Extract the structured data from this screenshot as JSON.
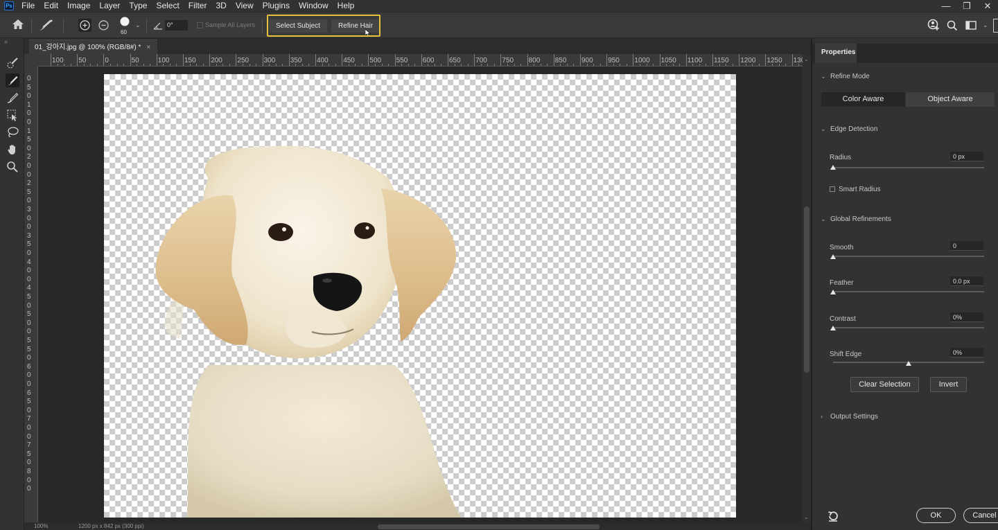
{
  "app": {
    "logo_text": "Ps"
  },
  "menu": [
    "File",
    "Edit",
    "Image",
    "Layer",
    "Type",
    "Select",
    "Filter",
    "3D",
    "View",
    "Plugins",
    "Window",
    "Help"
  ],
  "options_bar": {
    "brush_size": "60",
    "angle_value": "0°",
    "sample_all_layers": "Sample All Layers",
    "select_subject": "Select Subject",
    "refine_hair": "Refine Hair"
  },
  "document": {
    "tab_title": "01_강아지.jpg @ 100% (RGB/8#) *",
    "zoom_status": "100%",
    "size_status": "1200 px x 842 px (300 ppi)"
  },
  "ruler": {
    "top_labels": [
      "100",
      "50",
      "0",
      "50",
      "100",
      "150",
      "200",
      "250",
      "300",
      "350",
      "400",
      "450",
      "500",
      "550",
      "600",
      "650",
      "700",
      "750",
      "800",
      "850",
      "900",
      "950",
      "1000",
      "1050",
      "1100",
      "1150",
      "1200",
      "1250",
      "130"
    ],
    "left_labels": [
      "0",
      "5",
      "0",
      "1",
      "0",
      "0",
      "1",
      "5",
      "0",
      "2",
      "0",
      "0",
      "2",
      "5",
      "0",
      "3",
      "0",
      "0",
      "3",
      "5",
      "0",
      "4",
      "0",
      "0",
      "4",
      "5",
      "0",
      "5",
      "0",
      "0",
      "5",
      "5",
      "0",
      "6",
      "0",
      "0",
      "6",
      "5",
      "0",
      "7",
      "0",
      "0",
      "7",
      "5",
      "0",
      "8",
      "0",
      "0"
    ]
  },
  "properties": {
    "tab_label": "Properties",
    "refine_mode": {
      "title": "Refine Mode",
      "color_aware": "Color Aware",
      "object_aware": "Object Aware",
      "selected": "Color Aware"
    },
    "edge_detection": {
      "title": "Edge Detection",
      "radius_label": "Radius",
      "radius_value": "0 px",
      "radius_level": 0,
      "smart_radius_label": "Smart Radius",
      "smart_radius_checked": false
    },
    "global_refinements": {
      "title": "Global Refinements",
      "smooth_label": "Smooth",
      "smooth_value": "0",
      "smooth_level": 0,
      "feather_label": "Feather",
      "feather_value": "0.0 px",
      "feather_level": 0,
      "contrast_label": "Contrast",
      "contrast_value": "0%",
      "contrast_level": 0,
      "shift_edge_label": "Shift Edge",
      "shift_edge_value": "0%",
      "shift_edge_level": 0.5
    },
    "clear_selection": "Clear Selection",
    "invert": "Invert",
    "output_settings": "Output Settings",
    "ok": "OK",
    "cancel": "Cancel"
  },
  "colors": {
    "highlight": "#e8c13a",
    "panel_bg": "#323232",
    "canvas_bg": "#282828"
  },
  "icons": [
    "home-icon",
    "brush-tool-icon",
    "add-to-selection-icon",
    "subtract-from-selection-icon",
    "brush-preview-icon",
    "angle-icon",
    "learn-icon",
    "search-icon",
    "workspace-icon",
    "reset-icon"
  ]
}
